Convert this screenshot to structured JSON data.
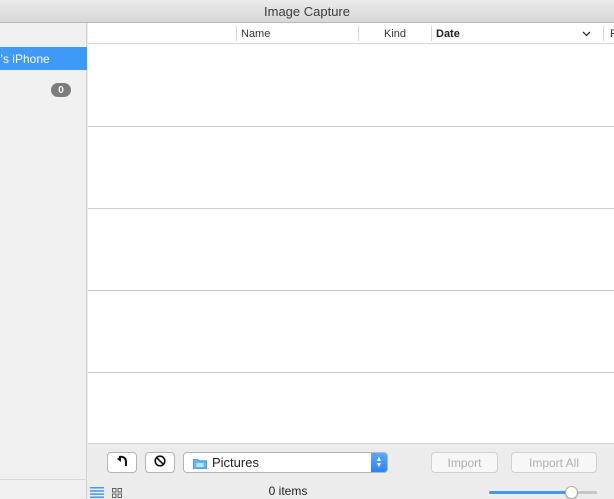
{
  "window": {
    "title": "Image Capture"
  },
  "sidebar": {
    "selected_device": "g's iPhone",
    "item_count": "0"
  },
  "table": {
    "columns": [
      "Name",
      "Kind",
      "Date",
      "F"
    ],
    "sort_indicator": "chevron-down-icon",
    "rows": []
  },
  "toolbar": {
    "rotate_icon": "rotate-left-icon",
    "delete_icon": "no-entry-icon",
    "folder": {
      "icon": "folder-icon",
      "value": "Pictures"
    },
    "import_label": "Import",
    "import_all_label": "Import All"
  },
  "footer": {
    "items_label": "0 items",
    "thumbnail_size": 0.77
  },
  "colors": {
    "accent": "#3f99f6",
    "badge": "#7c7c7c"
  }
}
